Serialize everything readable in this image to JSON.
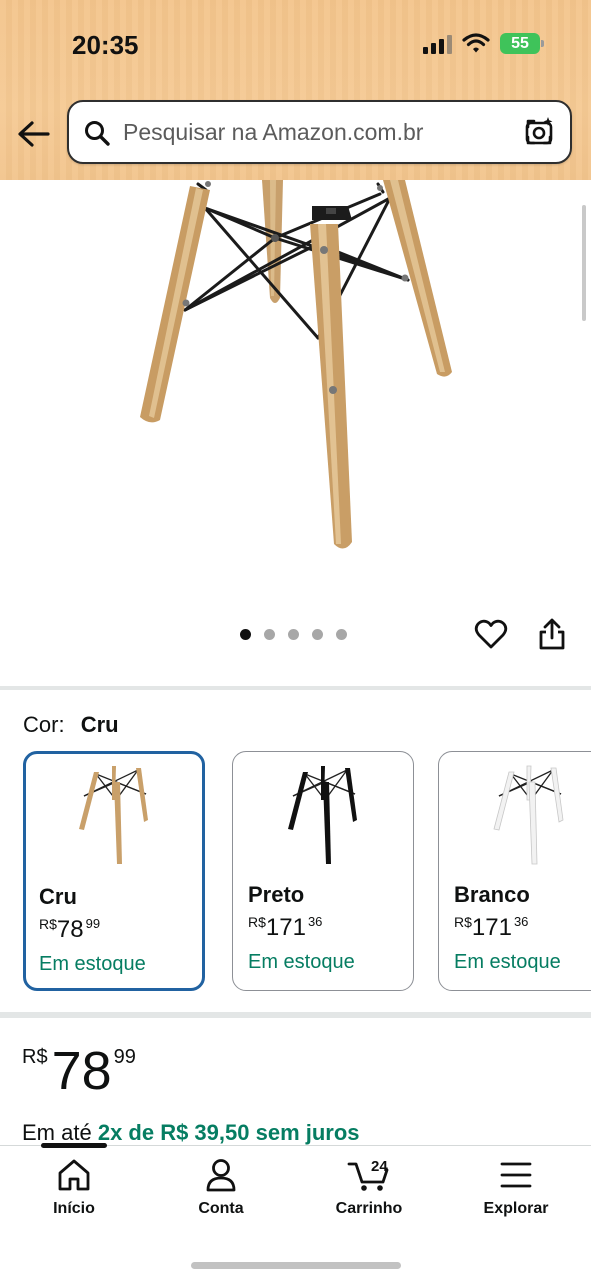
{
  "status_bar": {
    "time": "20:35",
    "battery": "55",
    "battery_color": "#3fc35a"
  },
  "header": {
    "background_color": "#f4c690",
    "back_icon": "arrow-left-icon",
    "search": {
      "placeholder": "Pesquisar na Amazon.com.br",
      "value": "",
      "icon": "search-icon",
      "camera_icon": "camera-search-icon"
    }
  },
  "product_gallery": {
    "image": "wooden-chair-base-icon",
    "image_count": 5,
    "active_image_index": 0,
    "favorite_icon": "heart-icon",
    "share_icon": "share-icon"
  },
  "color_selector": {
    "label": "Cor:",
    "selected_value": "Cru",
    "selected_border_color": "#2162a1",
    "variants": [
      {
        "name": "Cru",
        "currency": "R$",
        "price_whole": "78",
        "price_cents": "99",
        "stock": "Em estoque",
        "leg_color": "#c9a06a",
        "selected": true
      },
      {
        "name": "Preto",
        "currency": "R$",
        "price_whole": "171",
        "price_cents": "36",
        "stock": "Em estoque",
        "leg_color": "#111111",
        "selected": false
      },
      {
        "name": "Branco",
        "currency": "R$",
        "price_whole": "171",
        "price_cents": "36",
        "stock": "Em estoque",
        "leg_color": "#f2f2f2",
        "selected": false
      }
    ]
  },
  "price": {
    "currency": "R$",
    "whole": "78",
    "cents": "99",
    "installments_prefix": "Em até",
    "installments_offer": "2x de R$ 39,50 sem juros",
    "offer_color": "#067d62"
  },
  "bottom_nav": {
    "items": [
      {
        "label": "Início",
        "icon": "home-icon",
        "active": true
      },
      {
        "label": "Conta",
        "icon": "account-icon",
        "active": false
      },
      {
        "label": "Carrinho",
        "icon": "cart-icon",
        "badge": "24",
        "active": false
      },
      {
        "label": "Explorar",
        "icon": "menu-icon",
        "active": false
      }
    ]
  }
}
